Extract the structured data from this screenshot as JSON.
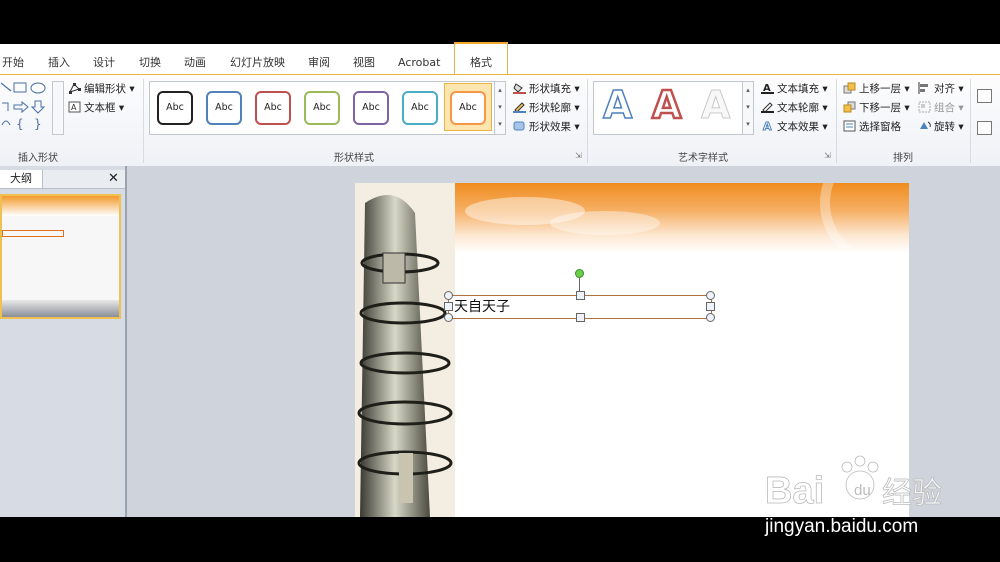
{
  "tabs": [
    "开始",
    "插入",
    "设计",
    "切换",
    "动画",
    "幻灯片放映",
    "审阅",
    "视图",
    "Acrobat",
    "格式"
  ],
  "active_tab": "格式",
  "groups": {
    "insert_shapes": {
      "label": "插入形状",
      "edit_shape": "编辑形状",
      "text_box": "文本框"
    },
    "shape_styles": {
      "label": "形状样式",
      "preset_label": "Abc",
      "fill": "形状填充",
      "outline": "形状轮廓",
      "effects": "形状效果"
    },
    "wordart": {
      "label": "艺术字样式",
      "letter": "A",
      "text_fill": "文本填充",
      "text_outline": "文本轮廓",
      "text_effects": "文本效果"
    },
    "arrange": {
      "label": "排列",
      "bring_forward": "上移一层",
      "send_backward": "下移一层",
      "selection_pane": "选择窗格",
      "align": "对齐",
      "group": "组合",
      "rotate": "旋转"
    }
  },
  "style_colors": [
    "#222222",
    "#4f81bd",
    "#c0504d",
    "#9bbb59",
    "#8064a2",
    "#4bacc6",
    "#f79646"
  ],
  "wordart_colors": [
    "#4f81bd",
    "#c0504d",
    "#e8e8e8"
  ],
  "panel": {
    "tab_label": "大纲",
    "close": "✕"
  },
  "slide": {
    "textbox_text": "天自天子"
  },
  "watermark": {
    "url": "jingyan.baidu.com"
  }
}
